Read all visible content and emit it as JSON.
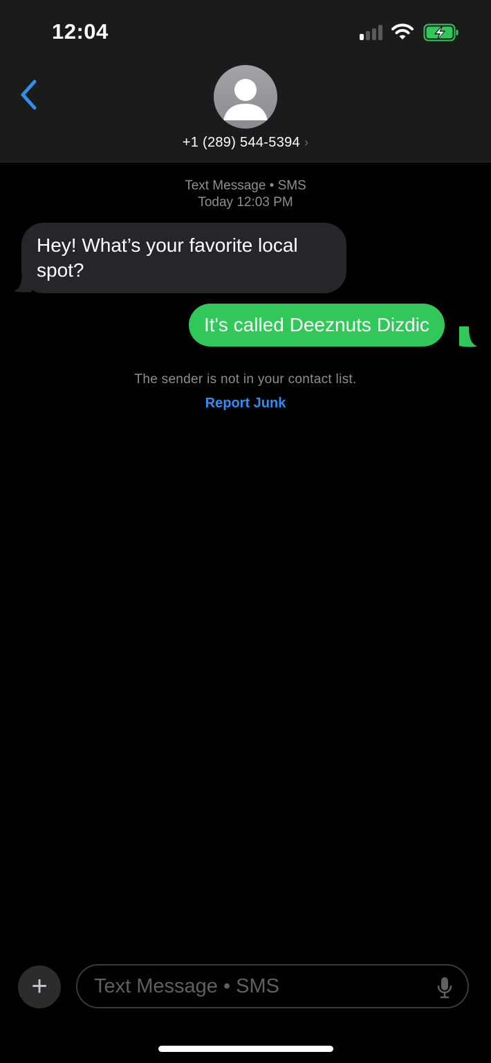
{
  "status_bar": {
    "time": "12:04",
    "signal_bars_active": 1,
    "battery_state": "charging"
  },
  "header": {
    "back_icon": "chevron-left-icon",
    "contact": "+1 (289) 544-5394",
    "contact_chevron": "›"
  },
  "conversation": {
    "service_label": "Text Message • SMS",
    "timestamp": "Today 12:03 PM",
    "messages": [
      {
        "direction": "incoming",
        "text": "Hey! What’s your favorite local spot?"
      },
      {
        "direction": "outgoing",
        "text": "It's called Deeznuts Dizdic"
      }
    ],
    "notice": "The sender is not in your contact list.",
    "report_link": "Report Junk"
  },
  "composer": {
    "add_label": "+",
    "placeholder": "Text Message • SMS"
  },
  "colors": {
    "accent": "#2f8ff0",
    "outgoing_bubble": "#32c759",
    "incoming_bubble": "#26252a",
    "battery_charging": "#32c759"
  }
}
